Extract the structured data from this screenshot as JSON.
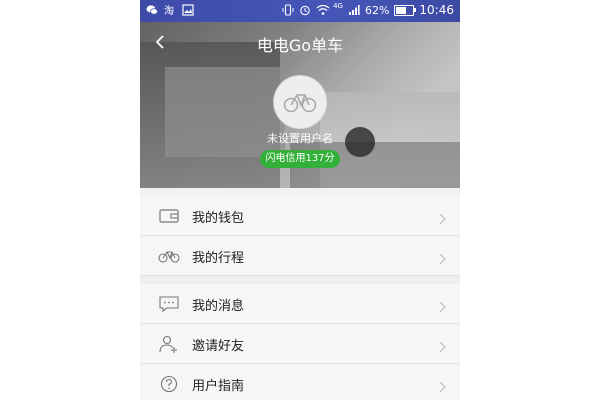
{
  "statusbar": {
    "battery_percent": "62%",
    "battery_level": 0.62,
    "network": "4G",
    "time": "10:46"
  },
  "header": {
    "title": "电电Go单车"
  },
  "profile": {
    "username": "未设置用户名",
    "credit": "闪电信用137分"
  },
  "menu": {
    "items": [
      {
        "label": "我的钱包",
        "icon": "wallet-icon"
      },
      {
        "label": "我的行程",
        "icon": "bicycle-icon"
      },
      {
        "label": "我的消息",
        "icon": "message-icon"
      },
      {
        "label": "邀请好友",
        "icon": "add-user-icon"
      },
      {
        "label": "用户指南",
        "icon": "question-icon"
      }
    ]
  },
  "colors": {
    "statusbar": "#3d4aa8",
    "credit_badge": "#33b03a",
    "menu_bg": "#f6f6f6"
  }
}
